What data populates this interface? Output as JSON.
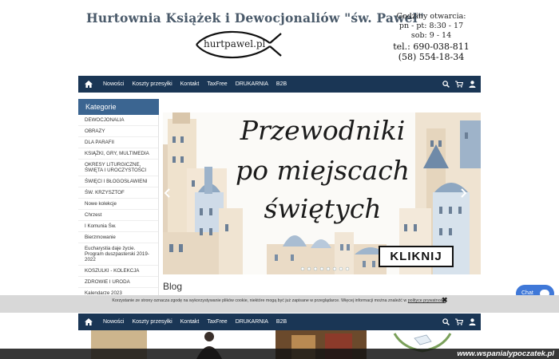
{
  "header": {
    "title": "Hurtownia Książek i Dewocjonaliów \"św. Paweł\"",
    "logo_text": "hurtpawel.pl",
    "hours_title": "Godziny otwarcia:",
    "hours_weekday": "pn - pt: 8:30 - 17",
    "hours_saturday": "sob: 9 - 14",
    "phone_mobile": "tel.: 690-038-811",
    "phone_landline": "(58) 554-18-34"
  },
  "nav": {
    "items": [
      "Nowości",
      "Koszty przesyłki",
      "Kontakt",
      "TaxFree",
      "DRUKARNIA",
      "B2B"
    ],
    "icons": [
      "home-icon",
      "search-icon",
      "cart-icon",
      "user-icon"
    ]
  },
  "sidebar": {
    "heading": "Kategorie",
    "categories": [
      "DEWOCJONALIA",
      "OBRAZY",
      "DLA PARAFII",
      "KSIĄŻKI, GRY, MULTIMEDIA",
      "OKRESY LITURGICZNE, ŚWIĘTA I UROCZYSTOŚCI",
      "ŚWIĘCI I BŁOGOSŁAWIENI",
      "ŚW. KRZYSZTOF",
      "Nowe kolekcje",
      "Chrzest",
      "I Komunia Św.",
      "Bierzmowanie",
      "Eucharystia daje życie. Program duszpasterski 2019-2022",
      "KOSZULKI - KOLEKCJA",
      "ZDROWIE I URODA",
      "Kalendarze 2023"
    ]
  },
  "banner": {
    "line1": "Przewodniki",
    "line2": "po miejscach",
    "line3": "świętych",
    "button": "KLIKNIJ"
  },
  "blog": {
    "title": "Blog"
  },
  "chat": {
    "label": "Chat"
  },
  "cookie": {
    "text": "Korzystanie ze strony oznacza zgodę na wykorzystywanie plików cookie, niektóre mogą być już zapisane w przeglądarce. Więcej informacji można znaleźć w",
    "link": "polityce prywatności",
    "close": "✖"
  },
  "watermark": "www.wspanialypoczatek.pl",
  "colors": {
    "nav": "#1a3655",
    "sidebar_header": "#3b6591",
    "chat": "#3f78d8",
    "cookie_bar": "#d8d8d8"
  }
}
